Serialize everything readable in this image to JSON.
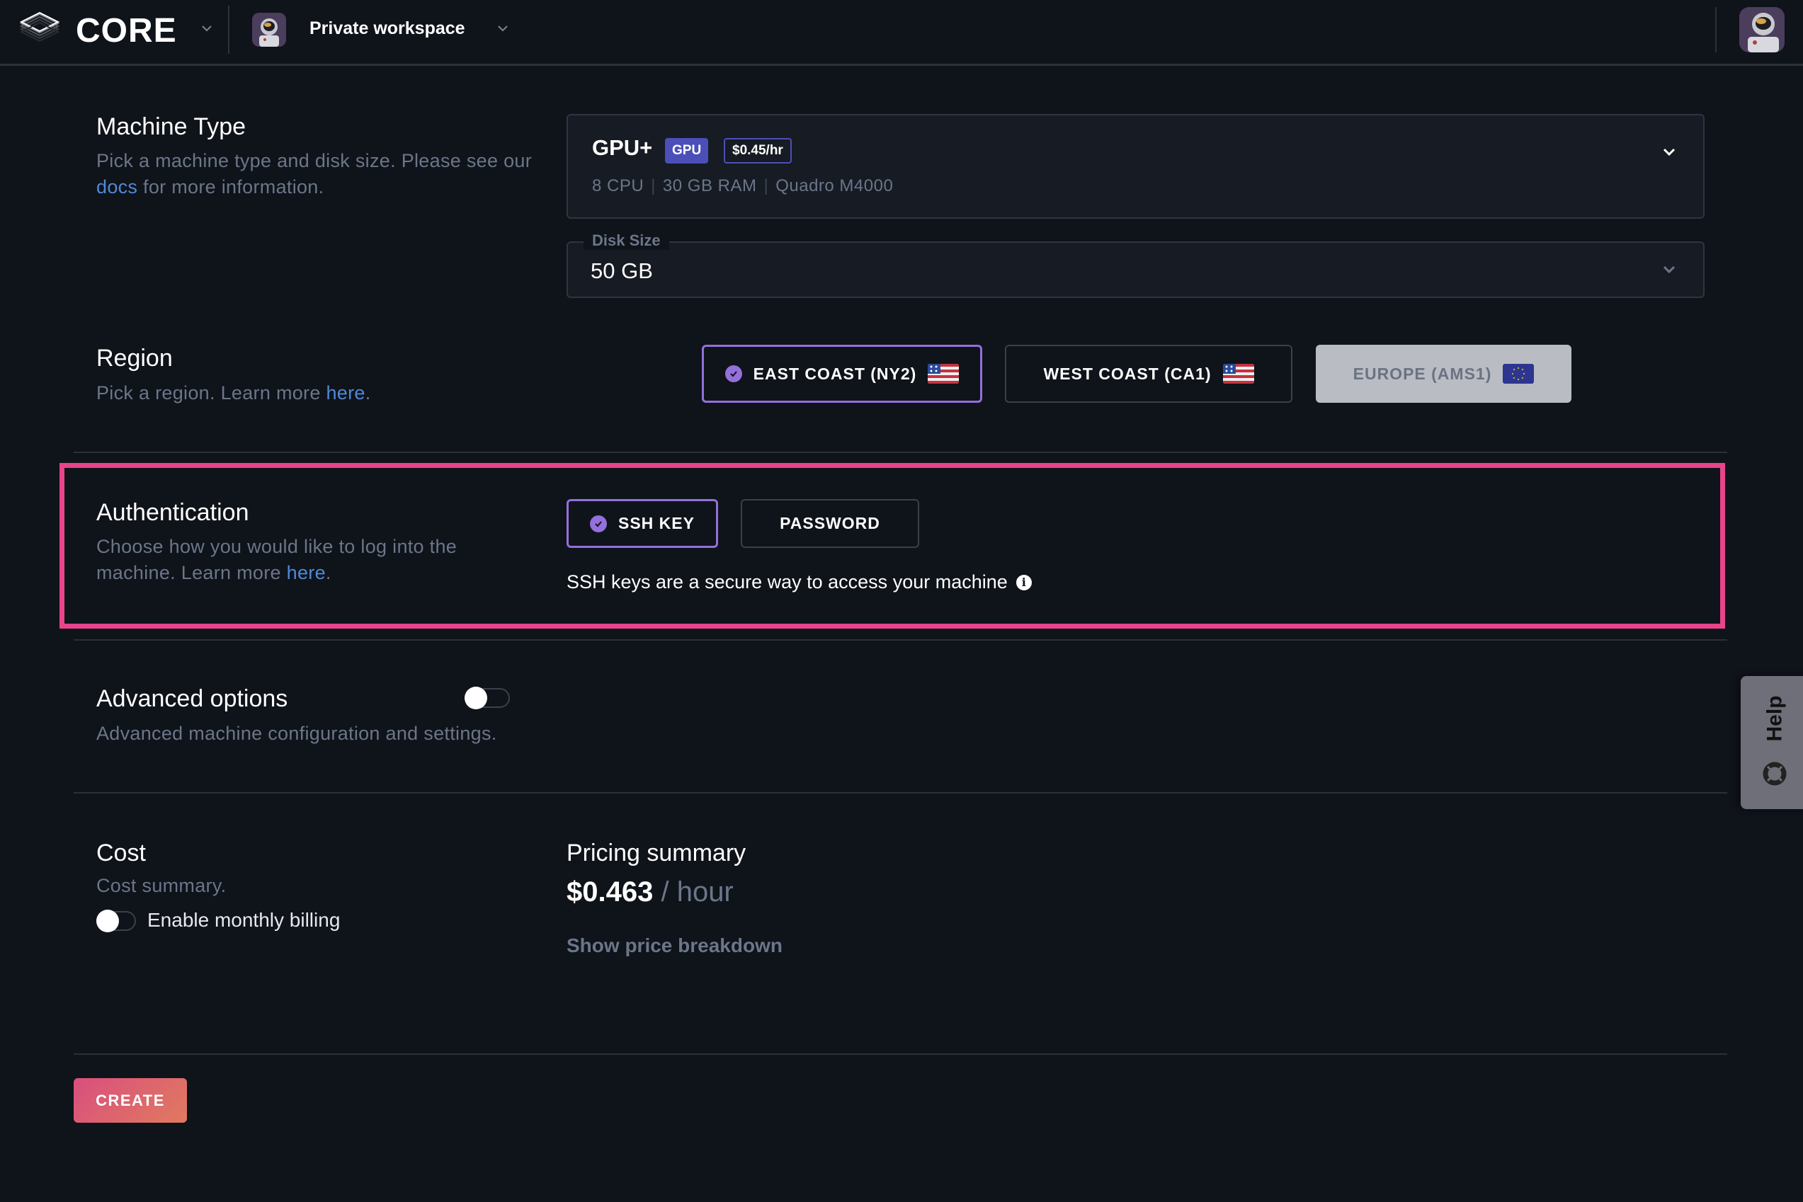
{
  "header": {
    "brand": "CORE",
    "workspace": "Private workspace"
  },
  "machine_type": {
    "title": "Machine Type",
    "desc_before": "Pick a machine type and disk size. Please see our ",
    "desc_link": "docs",
    "desc_after": " for more information.",
    "selected": {
      "name": "GPU+",
      "badge": "GPU",
      "price": "$0.45/hr",
      "cpu": "8 CPU",
      "ram": "30 GB RAM",
      "gpu": "Quadro M4000"
    },
    "disk_label": "Disk Size",
    "disk_value": "50 GB"
  },
  "region": {
    "title": "Region",
    "desc_before": "Pick a region. Learn more ",
    "desc_link": "here",
    "desc_after": ".",
    "options": [
      {
        "label": "EAST COAST (NY2)",
        "flag": "us-flag",
        "state": "selected"
      },
      {
        "label": "WEST COAST (CA1)",
        "flag": "us-flag",
        "state": "default"
      },
      {
        "label": "EUROPE (AMS1)",
        "flag": "eu-flag",
        "state": "disabled"
      }
    ]
  },
  "authentication": {
    "title": "Authentication",
    "desc_before": "Choose how you would like to log into the machine. Learn more ",
    "desc_link": "here",
    "desc_after": ".",
    "options": [
      {
        "label": "SSH KEY",
        "state": "selected"
      },
      {
        "label": "PASSWORD",
        "state": "default"
      }
    ],
    "info": "SSH keys are a secure way to access your machine"
  },
  "advanced": {
    "title": "Advanced options",
    "desc": "Advanced machine configuration and settings.",
    "enabled": false
  },
  "cost": {
    "title": "Cost",
    "desc": "Cost summary.",
    "monthly_billing_label": "Enable monthly billing",
    "monthly_billing_enabled": false,
    "pricing_title": "Pricing summary",
    "amount": "$0.463",
    "unit": "/ hour",
    "breakdown_link": "Show price breakdown"
  },
  "actions": {
    "create": "CREATE"
  },
  "help": {
    "label": "Help"
  },
  "colors": {
    "accent": "#9370db",
    "highlight": "#e8448c",
    "badge": "#4b4fb8",
    "link": "#4f8ad6"
  }
}
